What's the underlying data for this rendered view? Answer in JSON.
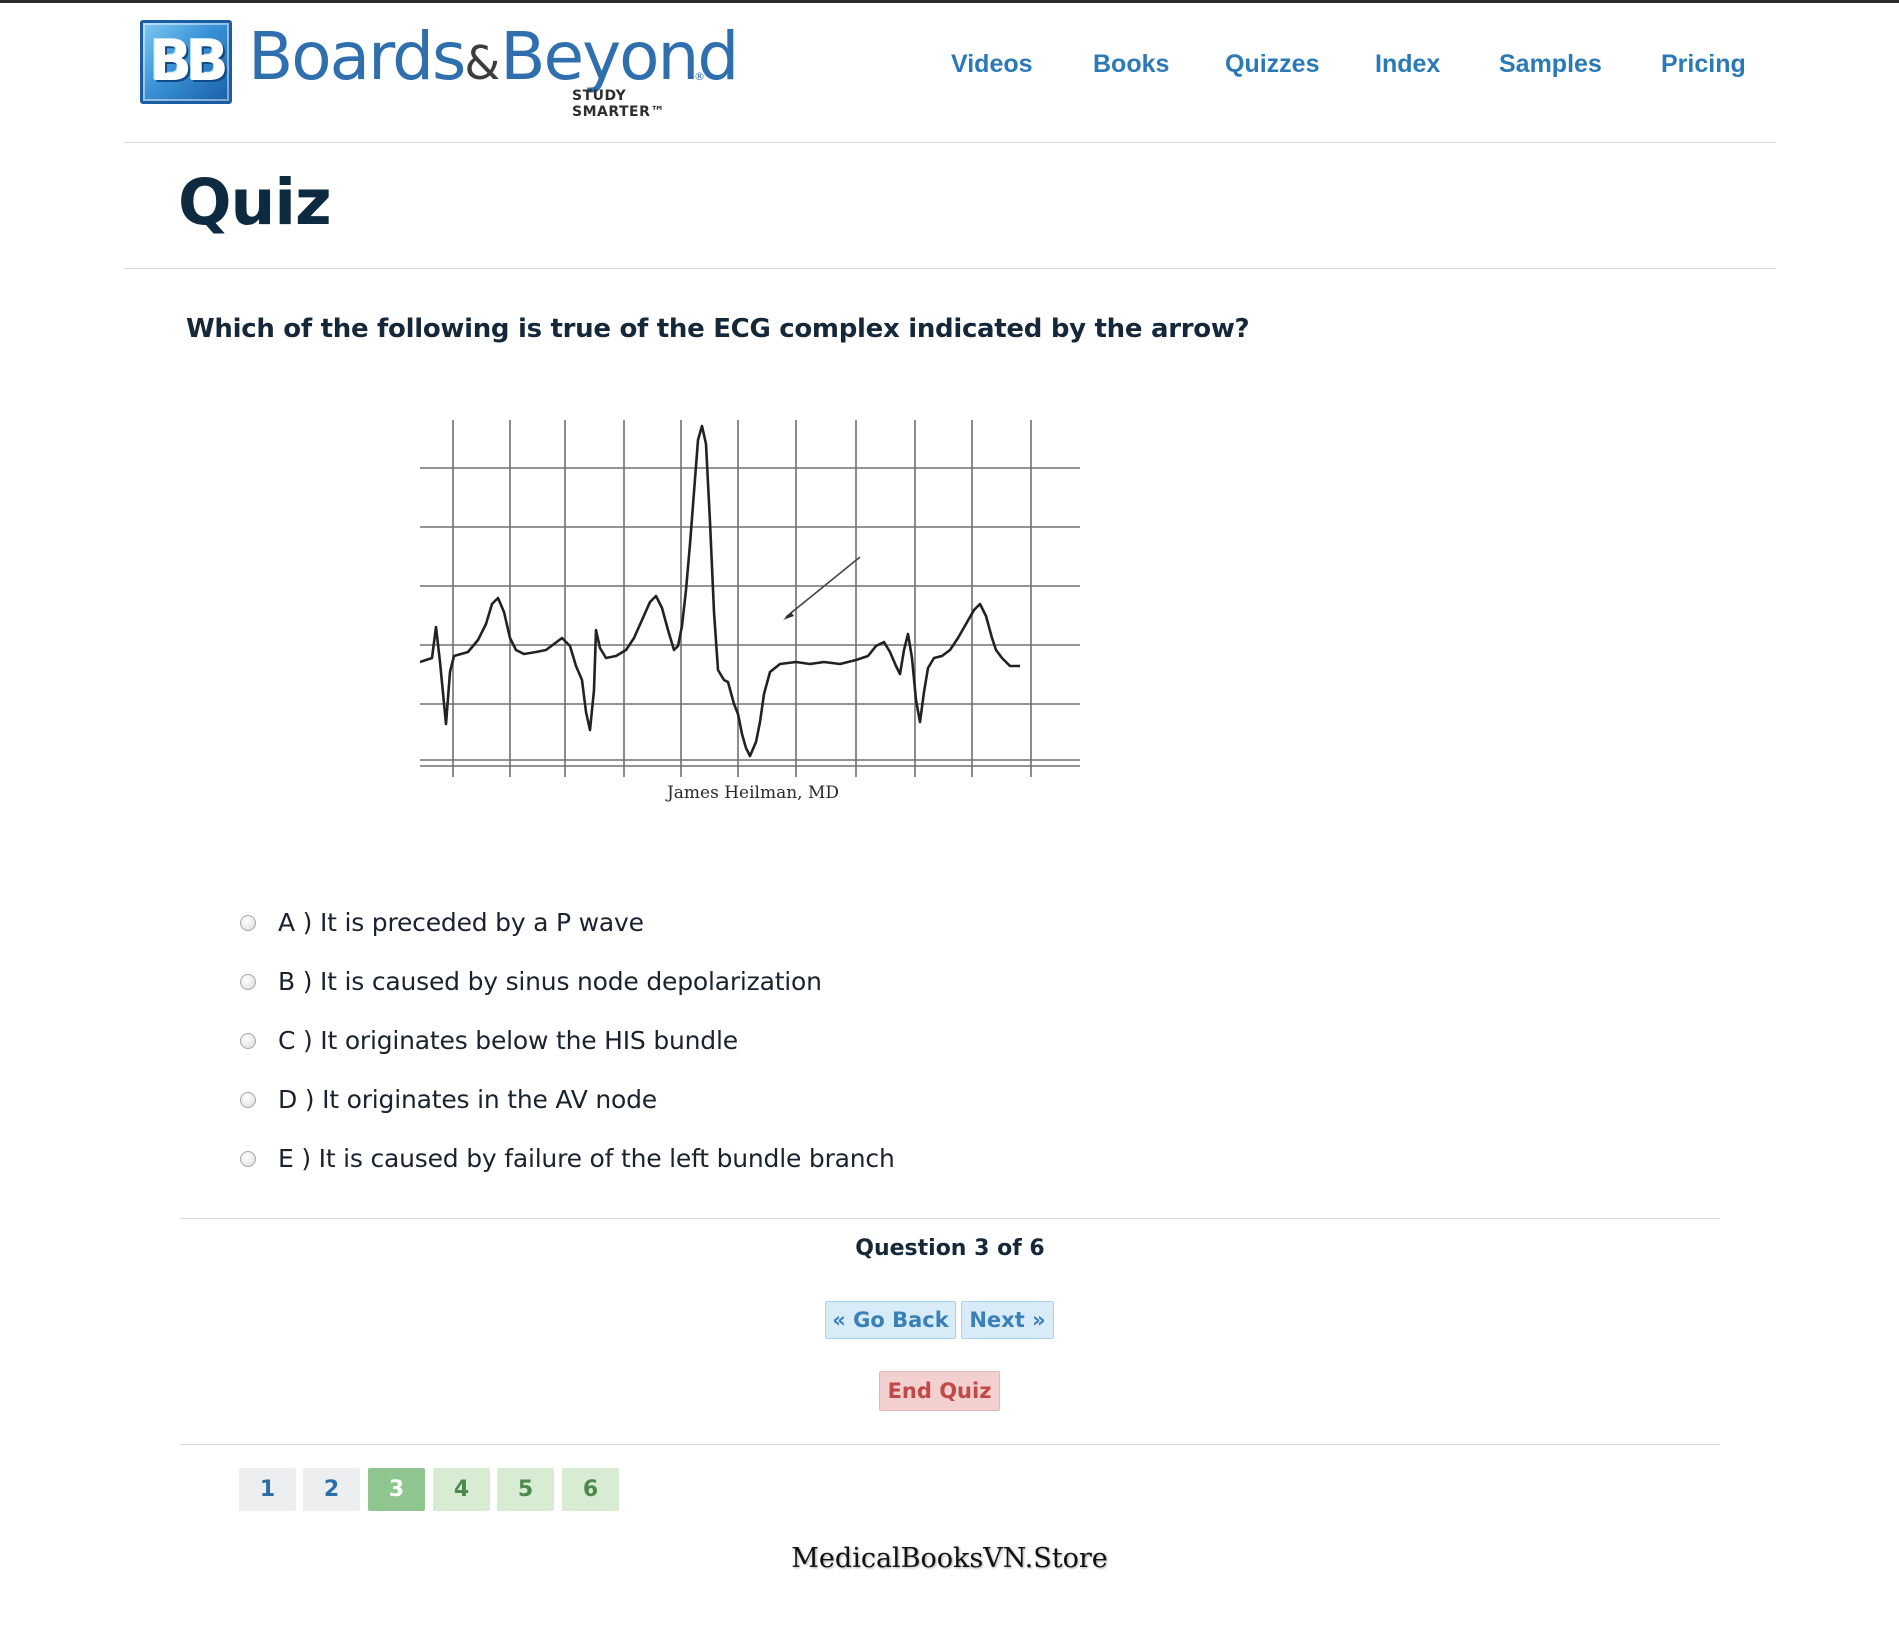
{
  "brand": {
    "mark": "BB",
    "name_first": "Boards",
    "name_amp": "&",
    "name_second": "Beyond",
    "registered": "®",
    "tagline": "STUDY SMARTER™"
  },
  "nav": {
    "items": [
      "Videos",
      "Books",
      "Quizzes",
      "Index",
      "Samples",
      "Pricing"
    ]
  },
  "page": {
    "title": "Quiz"
  },
  "question": {
    "text": "Which of the following is true of the ECG complex indicated by the arrow?",
    "image_credit": "James Heilman, MD",
    "options": [
      "A ) It is preceded by a P wave",
      "B ) It is caused by sinus node depolarization",
      "C ) It originates below the HIS bundle",
      "D ) It originates in the AV node",
      "E ) It is caused by failure of the left bundle branch"
    ]
  },
  "progress": {
    "counter": "Question 3 of 6",
    "current": 3,
    "total": 6
  },
  "buttons": {
    "back": "« Go Back",
    "next": "Next »",
    "end": "End Quiz"
  },
  "pagination": [
    "1",
    "2",
    "3",
    "4",
    "5",
    "6"
  ],
  "watermark": "MedicalBooksVN.Store",
  "colors": {
    "nav_link": "#2a7ab8",
    "title": "#0e2a40",
    "nav_button_bg": "#d8ecf8",
    "end_button_bg": "#f2d0d0",
    "page_current": "#8fc68f",
    "page_upcoming": "#d8ecd3"
  }
}
